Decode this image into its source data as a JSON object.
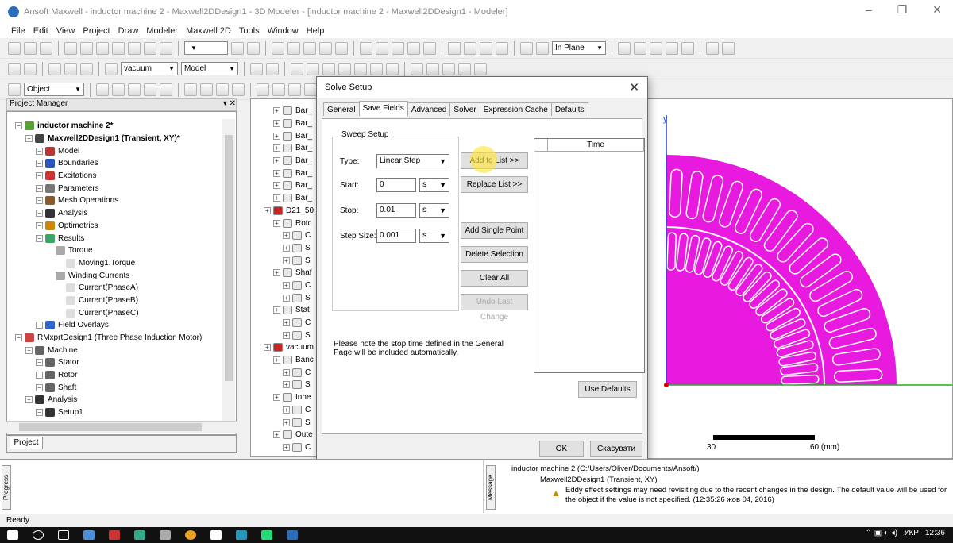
{
  "window": {
    "title": "Ansoft Maxwell - inductor machine 2 - Maxwell2DDesign1 - 3D Modeler - [inductor machine 2 - Maxwell2DDesign1 - Modeler]",
    "controls": [
      "–",
      "❐",
      "✕"
    ]
  },
  "menu": [
    "File",
    "Edit",
    "View",
    "Project",
    "Draw",
    "Modeler",
    "Maxwell 2D",
    "Tools",
    "Window",
    "Help"
  ],
  "toolbar": {
    "material": "vacuum",
    "model": "Model",
    "plane": "In Plane",
    "select_mode": "Object"
  },
  "project_manager": {
    "title": "Project Manager",
    "tab": "Project",
    "tree": [
      {
        "label": "inductor machine 2*",
        "depth": 0,
        "bold": true,
        "icon_color": "#5a9e3a"
      },
      {
        "label": "Maxwell2DDesign1 (Transient, XY)*",
        "depth": 1,
        "bold": true,
        "icon_color": "#444"
      },
      {
        "label": "Model",
        "depth": 2,
        "icon_color": "#b33"
      },
      {
        "label": "Boundaries",
        "depth": 2,
        "icon_color": "#2a55bb"
      },
      {
        "label": "Excitations",
        "depth": 2,
        "icon_color": "#c33"
      },
      {
        "label": "Parameters",
        "depth": 2,
        "icon_color": "#777"
      },
      {
        "label": "Mesh Operations",
        "depth": 2,
        "icon_color": "#8a5a2a"
      },
      {
        "label": "Analysis",
        "depth": 2,
        "icon_color": "#333"
      },
      {
        "label": "Optimetrics",
        "depth": 2,
        "icon_color": "#c80"
      },
      {
        "label": "Results",
        "depth": 2,
        "icon_color": "#3a6"
      },
      {
        "label": "Torque",
        "depth": 3,
        "icon_color": "#aaa"
      },
      {
        "label": "Moving1.Torque",
        "depth": 4,
        "icon_color": "#ddd"
      },
      {
        "label": "Winding Currents",
        "depth": 3,
        "icon_color": "#aaa"
      },
      {
        "label": "Current(PhaseA)",
        "depth": 4,
        "icon_color": "#ddd"
      },
      {
        "label": "Current(PhaseB)",
        "depth": 4,
        "icon_color": "#ddd"
      },
      {
        "label": "Current(PhaseC)",
        "depth": 4,
        "icon_color": "#ddd"
      },
      {
        "label": "Field Overlays",
        "depth": 2,
        "icon_color": "#36c"
      },
      {
        "label": "RMxprtDesign1 (Three Phase Induction Motor)",
        "depth": 0,
        "icon_color": "#c44"
      },
      {
        "label": "Machine",
        "depth": 1,
        "icon_color": "#666"
      },
      {
        "label": "Stator",
        "depth": 2,
        "icon_color": "#666"
      },
      {
        "label": "Rotor",
        "depth": 2,
        "icon_color": "#666"
      },
      {
        "label": "Shaft",
        "depth": 2,
        "icon_color": "#666"
      },
      {
        "label": "Analysis",
        "depth": 1,
        "icon_color": "#333"
      },
      {
        "label": "Setup1",
        "depth": 2,
        "icon_color": "#333"
      }
    ]
  },
  "model_tree": [
    {
      "label": "Bar_",
      "depth": 1
    },
    {
      "label": "Bar_",
      "depth": 1
    },
    {
      "label": "Bar_",
      "depth": 1
    },
    {
      "label": "Bar_",
      "depth": 1
    },
    {
      "label": "Bar_",
      "depth": 1
    },
    {
      "label": "Bar_",
      "depth": 1
    },
    {
      "label": "Bar_",
      "depth": 1
    },
    {
      "label": "Bar_",
      "depth": 1
    },
    {
      "label": "D21_50_",
      "depth": 0
    },
    {
      "label": "Rotc",
      "depth": 1
    },
    {
      "label": "C",
      "depth": 2
    },
    {
      "label": "S",
      "depth": 2
    },
    {
      "label": "S",
      "depth": 2
    },
    {
      "label": "Shaf",
      "depth": 1
    },
    {
      "label": "C",
      "depth": 2
    },
    {
      "label": "S",
      "depth": 2
    },
    {
      "label": "Stat",
      "depth": 1
    },
    {
      "label": "C",
      "depth": 2
    },
    {
      "label": "S",
      "depth": 2
    },
    {
      "label": "vacuum",
      "depth": 0
    },
    {
      "label": "Banc",
      "depth": 1
    },
    {
      "label": "C",
      "depth": 2
    },
    {
      "label": "S",
      "depth": 2
    },
    {
      "label": "Inne",
      "depth": 1
    },
    {
      "label": "C",
      "depth": 2
    },
    {
      "label": "S",
      "depth": 2
    },
    {
      "label": "Oute",
      "depth": 1
    },
    {
      "label": "C",
      "depth": 2
    }
  ],
  "dialog": {
    "title": "Solve Setup",
    "close": "✕",
    "tabs": [
      "General",
      "Save Fields",
      "Advanced",
      "Solver",
      "Expression Cache",
      "Defaults"
    ],
    "active_tab": "Save Fields",
    "group_title": "Sweep Setup",
    "type_label": "Type:",
    "type_value": "Linear Step",
    "start_label": "Start:",
    "start_value": "0",
    "start_unit": "s",
    "stop_label": "Stop:",
    "stop_value": "0.01",
    "stop_unit": "s",
    "step_label": "Step Size:",
    "step_value": "0.001",
    "step_unit": "s",
    "buttons": {
      "add_to_list": "Add to List >>",
      "replace_list": "Replace List >>",
      "add_single_point": "Add Single Point",
      "delete_selection": "Delete Selection",
      "clear_all": "Clear All",
      "undo_last_change": "Undo Last Change",
      "use_defaults": "Use Defaults",
      "ok": "OK",
      "cancel": "Скасувати"
    },
    "time_header": "Time",
    "note": "Please note the stop time defined in the General Page will be included automatically."
  },
  "canvas": {
    "axis_y": "y",
    "scale": [
      "30",
      "60 (mm)"
    ],
    "rotor_color": "#e81ae0",
    "slot_count_visible": 16
  },
  "messages": {
    "progress_label": "Progress",
    "message_label": "Message",
    "project": "inductor machine 2 (C:/Users/Oliver/Documents/Ansoft/)",
    "design": "Maxwell2DDesign1 (Transient, XY)",
    "warning_line1": "Eddy effect settings may need revisiting due to the recent changes in the design.  The default value will be used for",
    "warning_line2": "the object if the value is not specified.  (12:35:26  жов 04, 2016)"
  },
  "status": "Ready",
  "tray": {
    "lang": "УКР",
    "time": "12:36"
  }
}
